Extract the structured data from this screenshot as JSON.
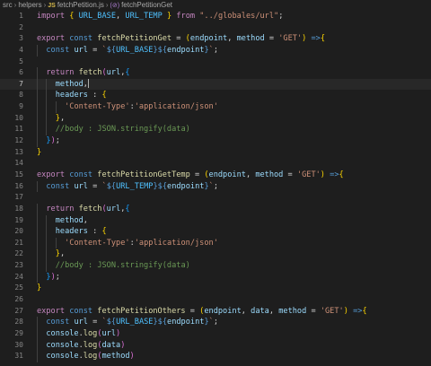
{
  "breadcrumb": {
    "items": [
      "src",
      "helpers",
      "fetchPetition.js",
      "fetchPetitionGet"
    ],
    "file_badge": "JS"
  },
  "editor": {
    "active_line": 7,
    "lines": [
      {
        "n": "1",
        "text": "import { URL_BASE, URL_TEMP } from \"../globales/url\";"
      },
      {
        "n": "2",
        "text": ""
      },
      {
        "n": "3",
        "text": "export const fetchPetitionGet = (endpoint, method = 'GET') =>{"
      },
      {
        "n": "4",
        "text": "  const url = `${URL_BASE}${endpoint}`;"
      },
      {
        "n": "5",
        "text": ""
      },
      {
        "n": "6",
        "text": "  return fetch(url,{"
      },
      {
        "n": "7",
        "text": "    method,"
      },
      {
        "n": "8",
        "text": "    headers : {"
      },
      {
        "n": "9",
        "text": "      'Content-Type':'application/json'"
      },
      {
        "n": "10",
        "text": "    },"
      },
      {
        "n": "11",
        "text": "    //body : JSON.stringify(data)"
      },
      {
        "n": "12",
        "text": "  });"
      },
      {
        "n": "13",
        "text": "}"
      },
      {
        "n": "14",
        "text": ""
      },
      {
        "n": "15",
        "text": "export const fetchPetitionGetTemp = (endpoint, method = 'GET') =>{"
      },
      {
        "n": "16",
        "text": "  const url = `${URL_TEMP}${endpoint}`;"
      },
      {
        "n": "17",
        "text": ""
      },
      {
        "n": "18",
        "text": "  return fetch(url,{"
      },
      {
        "n": "19",
        "text": "    method,"
      },
      {
        "n": "20",
        "text": "    headers : {"
      },
      {
        "n": "21",
        "text": "      'Content-Type':'application/json'"
      },
      {
        "n": "22",
        "text": "    },"
      },
      {
        "n": "23",
        "text": "    //body : JSON.stringify(data)"
      },
      {
        "n": "24",
        "text": "  });"
      },
      {
        "n": "25",
        "text": "}"
      },
      {
        "n": "26",
        "text": ""
      },
      {
        "n": "27",
        "text": "export const fetchPetitionOthers = (endpoint, data, method = 'GET') =>{"
      },
      {
        "n": "28",
        "text": "  const url = `${URL_BASE}${endpoint}`;"
      },
      {
        "n": "29",
        "text": "  console.log(url)"
      },
      {
        "n": "30",
        "text": "  console.log(data)"
      },
      {
        "n": "31",
        "text": "  console.log(method)"
      }
    ]
  },
  "colors": {
    "background": "#1e1e1e",
    "keyword": "#c586c0",
    "storage": "#569cd6",
    "function": "#dcdcaa",
    "variable": "#9cdcfe",
    "constant": "#4fc1ff",
    "string": "#ce9178",
    "comment": "#6a9955",
    "line_number": "#858585"
  },
  "icons": {
    "file_icon": "javascript-file-icon",
    "symbol_icon": "function-symbol-icon"
  }
}
